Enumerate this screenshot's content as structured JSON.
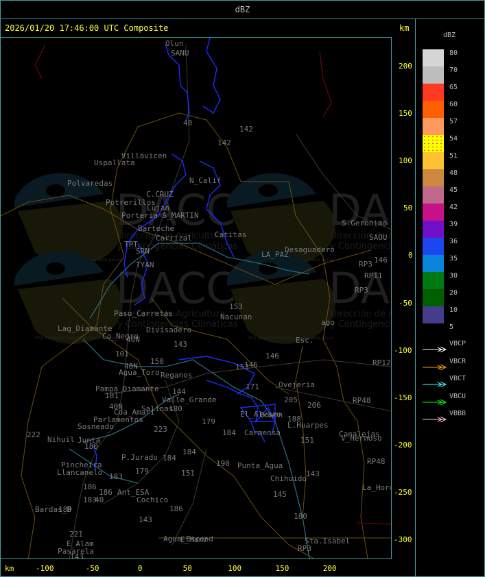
{
  "header": {
    "title": "dBZ"
  },
  "map": {
    "title": "2026/01/20 17:46:00 UTC Composite",
    "km_label": "km",
    "y_ticks": [
      "200",
      "150",
      "100",
      "50",
      "0",
      "-50",
      "-100",
      "-150",
      "-200",
      "-250",
      "-300"
    ],
    "x_ticks": [
      "-100",
      "-50",
      "0",
      "50",
      "100",
      "150",
      "200"
    ],
    "watermark": {
      "logo": "DACC",
      "line1": "Dirección de Agricultura",
      "line2": "y Contingencias Climáticas",
      "url": "http://www.contingencias.mendoza.gov.ar"
    },
    "places": [
      "Olun",
      "SANU",
      "40",
      "142",
      "142",
      "Villavicen",
      "Uspallata",
      "N_Calif",
      "Polvaredas",
      "Potrerillos",
      "C.CRUZ",
      "Lujan",
      "Porteria S_MARTIN",
      "Barteche",
      "Carrizal",
      "Catitas",
      "LA_PAZ",
      "Desaguadero",
      "S.Geronimo",
      "SAOU",
      "TPT",
      "SRN",
      "TYAN",
      "Paso_Carretas",
      "Divisadero",
      "Nacunan",
      "153",
      "Lag_Diamante",
      "Co_Negro",
      "40N",
      "143",
      "101",
      "150",
      "40N",
      "Agua_Toro",
      "Reganos",
      "153",
      "146",
      "146",
      "Esc.",
      "Pampa_Diamante",
      "101",
      "144",
      "Valle_Grande",
      "171",
      "Ovejeria",
      "205",
      "206",
      "40N",
      "Salinas",
      "180",
      "Cda_Amari",
      "Parlamentos",
      "Sosneado",
      "El_Alvaro",
      "Bowen",
      "188",
      "L.Huarpes",
      "179",
      "184",
      "Carmensa",
      "151",
      "Canalejas",
      "V_Hermoso",
      "222",
      "Nihuil",
      "223",
      "Junta",
      "180",
      "184",
      "184",
      "P.Jurado",
      "Pincheira",
      "Llancanelo",
      "183",
      "179",
      "190",
      "Punta_Agua",
      "151",
      "143",
      "Chihuido",
      "186",
      "186",
      "Ant_ESA",
      "40",
      "183",
      "Cochico",
      "145",
      "Bardas_B",
      "180",
      "186",
      "143",
      "180",
      "Agua_Escond",
      "E_Manz",
      "221",
      "E_Alam",
      "Pasarela",
      "143",
      "Sta.Isabel",
      "RP3",
      "146",
      "RP3",
      "RP11",
      "RP3",
      "RP12",
      "RP48",
      "RP48",
      "La_Horqueta",
      "ago"
    ]
  },
  "legend": {
    "title": "dBZ",
    "scale": [
      {
        "label": "80",
        "color": "#d6d6d6"
      },
      {
        "label": "70",
        "color": "#bdbdbd"
      },
      {
        "label": "65",
        "color": "#ff3a22"
      },
      {
        "label": "60",
        "color": "#ff5f00"
      },
      {
        "label": "57",
        "color": "#ff9a5e"
      },
      {
        "label": "54",
        "color": "#ffff00"
      },
      {
        "label": "51",
        "color": "#fcc233"
      },
      {
        "label": "48",
        "color": "#cd8840"
      },
      {
        "label": "45",
        "color": "#bf6a8a"
      },
      {
        "label": "42",
        "color": "#c8128a"
      },
      {
        "label": "39",
        "color": "#7010c8"
      },
      {
        "label": "36",
        "color": "#1c47ee"
      },
      {
        "label": "35",
        "color": "#0a84dc"
      },
      {
        "label": "30",
        "color": "#007a10"
      },
      {
        "label": "20",
        "color": "#005f00"
      },
      {
        "label": "10",
        "color": "#453c8a"
      },
      {
        "label": "5",
        "color": ""
      }
    ],
    "radars": [
      {
        "name": "VBCP",
        "color": "#ffffff"
      },
      {
        "name": "VBCR",
        "color": "#ffa500"
      },
      {
        "name": "VBCT",
        "color": "#33ffff"
      },
      {
        "name": "VBCU",
        "color": "#00ff00"
      },
      {
        "name": "VBBB",
        "color": "#ffc0cb"
      }
    ]
  }
}
